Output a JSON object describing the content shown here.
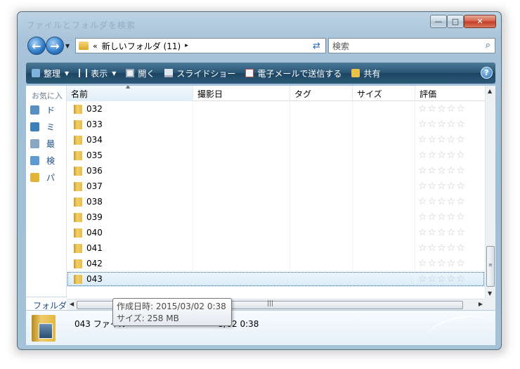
{
  "window": {
    "title": "ファイルとフォルダを検索",
    "controls": {
      "minimize": "—",
      "maximize": "□",
      "close": "✕"
    }
  },
  "address": {
    "chevron": "«",
    "path": "新しいフォルダ (11)",
    "separator": "▸"
  },
  "search": {
    "placeholder": "検索"
  },
  "toolbar": {
    "organize": "整理",
    "view": "表示",
    "open": "開く",
    "slideshow": "スライドショー",
    "email": "電子メールで送信する",
    "share": "共有",
    "help": "?"
  },
  "nav": {
    "header": "お気に入",
    "items": [
      {
        "label": "ド",
        "icon": "document-icon"
      },
      {
        "label": "ミ",
        "icon": "music-icon"
      },
      {
        "label": "最",
        "icon": "recent-icon"
      },
      {
        "label": "検",
        "icon": "search-folder-icon"
      },
      {
        "label": "パ",
        "icon": "folder-icon"
      }
    ],
    "folders_label": "フォルダ"
  },
  "columns": {
    "name": "名前",
    "date": "撮影日",
    "tags": "タグ",
    "size": "サイズ",
    "rating": "評価"
  },
  "files": [
    {
      "name": "032",
      "rating": 0
    },
    {
      "name": "033",
      "rating": 0
    },
    {
      "name": "034",
      "rating": 0
    },
    {
      "name": "035",
      "rating": 0
    },
    {
      "name": "036",
      "rating": 0
    },
    {
      "name": "037",
      "rating": 0
    },
    {
      "name": "038",
      "rating": 0
    },
    {
      "name": "039",
      "rating": 0
    },
    {
      "name": "040",
      "rating": 0
    },
    {
      "name": "041",
      "rating": 0
    },
    {
      "name": "042",
      "rating": 0
    },
    {
      "name": "043",
      "rating": 0
    }
  ],
  "selected": "043",
  "stars": "☆☆☆☆☆",
  "details": {
    "text": "043 ファイル",
    "date_visible": "3/02 0:38"
  },
  "tooltip": {
    "created": "作成日時: 2015/03/02 0:38",
    "size": "サイズ: 258 MB"
  },
  "colors": {
    "toolbar": "#2a5675",
    "selection": "#d8ebf9",
    "link": "#1e4f86"
  }
}
